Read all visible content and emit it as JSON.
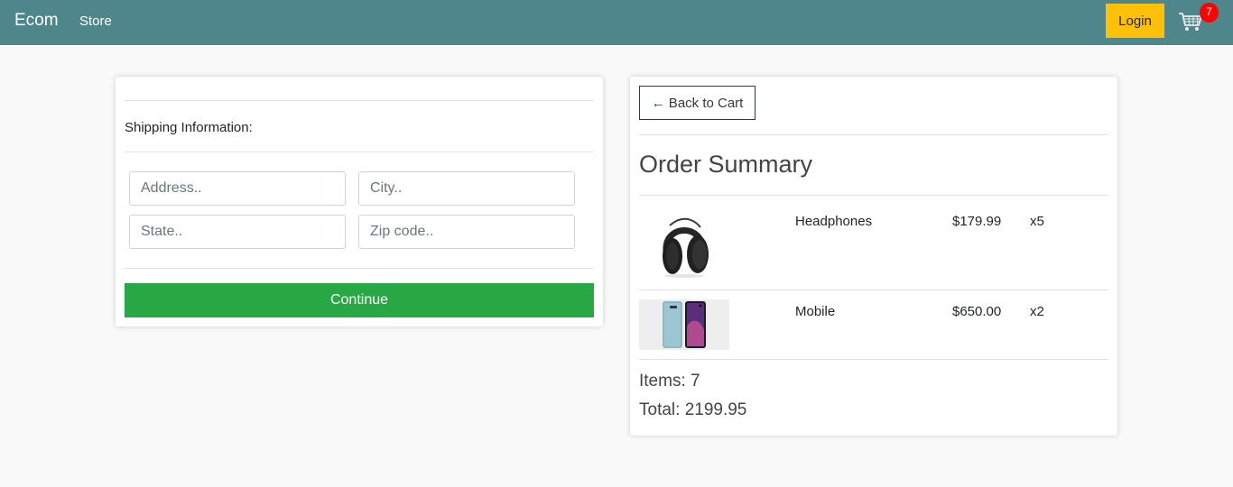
{
  "navbar": {
    "brand": "Ecom",
    "store_link": "Store",
    "login_label": "Login",
    "cart_count": "7",
    "bg_color": "#4f868c"
  },
  "shipping": {
    "heading": "Shipping Information:",
    "address_placeholder": "Address..",
    "city_placeholder": "City..",
    "state_placeholder": "State..",
    "zip_placeholder": "Zip code..",
    "continue_label": "Continue"
  },
  "summary": {
    "back_label": "← Back to Cart",
    "title": "Order Summary",
    "items": [
      {
        "name": "Headphones",
        "price": "$179.99",
        "qty": "x5",
        "icon": "headphones-image"
      },
      {
        "name": "Mobile",
        "price": "$650.00",
        "qty": "x2",
        "icon": "mobile-phone-image"
      }
    ],
    "items_count": "Items: 7",
    "total": "Total: 2199.95"
  }
}
